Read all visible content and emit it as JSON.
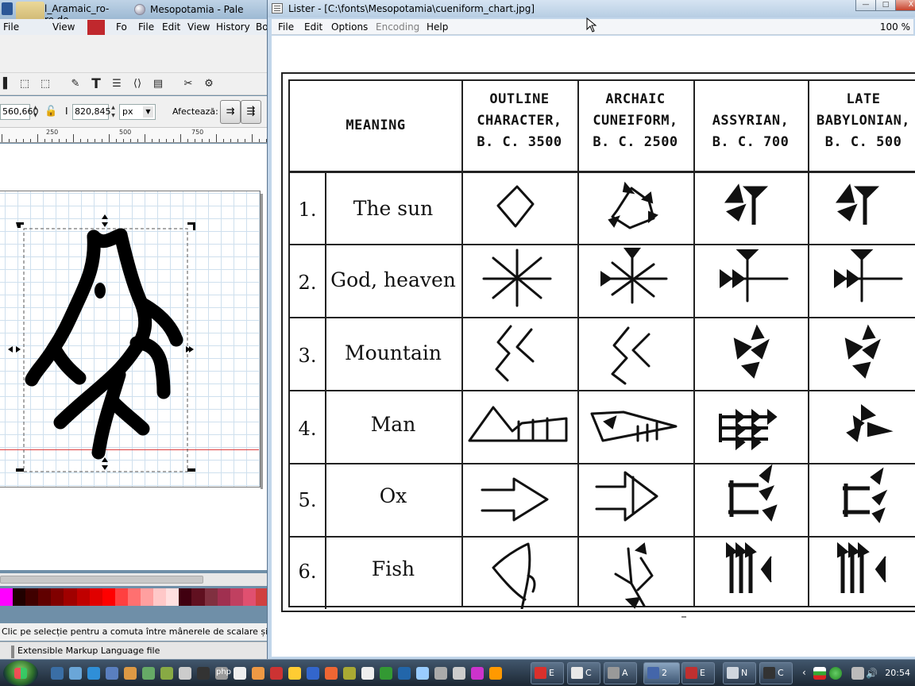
{
  "colors": {
    "accent": "#c2d6ea",
    "taskbar": "#1c2733",
    "ink_red_guide": "#e04040",
    "chart_ink": "#111111"
  },
  "word_window": {
    "title": "l_Aramaic_ro-ro.do",
    "menu": [
      "File",
      "View"
    ]
  },
  "palemoon_window": {
    "title": "Mesopotamia - Pale Moon",
    "menu": [
      "File",
      "Edit",
      "View",
      "History",
      "Bo"
    ]
  },
  "inkscape": {
    "menu": [
      "File",
      "View",
      "Fo"
    ],
    "toolbar_icons": [
      "select-icon",
      "node-icon",
      "pen-icon",
      "text-icon",
      "layers-icon",
      "xml-editor-icon",
      "align-icon",
      "transform-icon",
      "preferences-icon"
    ],
    "x_value": "560,660",
    "h_label": "I",
    "h_value": "820,845",
    "unit": "px",
    "affects_label": "Afectează:",
    "ruler_labels": [
      "250",
      "500",
      "750"
    ],
    "status_text": "Clic pe selecție pentru a comuta între mânerele de scalare și cele",
    "palette": [
      "#ff00ff",
      "#200000",
      "#400000",
      "#600000",
      "#800000",
      "#a00000",
      "#c00000",
      "#e00000",
      "#ff0000",
      "#ff4040",
      "#ff7070",
      "#ff9f9f",
      "#ffc8c8",
      "#ffe0e0",
      "#400010",
      "#601020",
      "#803040",
      "#a03050",
      "#c04060",
      "#e05070",
      "#d04040"
    ]
  },
  "word_status": {
    "text": "Extensible Markup Language file"
  },
  "lister": {
    "title": "Lister - [C:\\fonts\\Mesopotamia\\cueniform_chart.jpg]",
    "menu": {
      "file": "File",
      "edit": "Edit",
      "options": "Options",
      "encoding": "Encoding",
      "help": "Help"
    },
    "zoom": "100 %",
    "window_buttons": {
      "minimize": "—",
      "maximize": "□",
      "close": "X"
    }
  },
  "chart_data": {
    "type": "table",
    "headers": [
      {
        "lines": [
          "MEANING"
        ]
      },
      {
        "lines": [
          "OUTLINE",
          "CHARACTER,",
          "B. C.  3500"
        ]
      },
      {
        "lines": [
          "ARCHAIC",
          "CUNEIFORM,",
          "B. C.  2500"
        ]
      },
      {
        "lines": [
          "ASSYRIAN,",
          "B. C.  700"
        ]
      },
      {
        "lines": [
          "LATE",
          "BABYLONIAN,",
          "B. C.  500"
        ]
      }
    ],
    "rows": [
      {
        "num": "1.",
        "meaning": "The sun"
      },
      {
        "num": "2.",
        "meaning": "God, heaven"
      },
      {
        "num": "3.",
        "meaning": "Mountain"
      },
      {
        "num": "4.",
        "meaning": "Man"
      },
      {
        "num": "5.",
        "meaning": "Ox"
      },
      {
        "num": "6.",
        "meaning": "Fish"
      }
    ]
  },
  "taskbar": {
    "buttons": [
      {
        "label": "E",
        "color": "#d9302c"
      },
      {
        "label": "C",
        "color": "#e8e8e8"
      },
      {
        "label": "A",
        "color": "#999999"
      },
      {
        "label": "2",
        "color": "#4466aa"
      },
      {
        "label": "E",
        "color": "#c03030"
      },
      {
        "label": "N",
        "color": "#cfd6de"
      },
      {
        "label": "C",
        "color": "#333333"
      }
    ],
    "quicklaunch_text": "php",
    "clock": "20:54"
  }
}
